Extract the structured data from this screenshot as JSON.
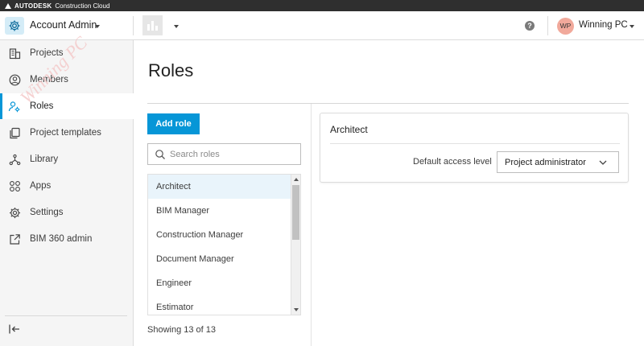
{
  "topbar": {
    "brand": "AUTODESK",
    "product": "Construction Cloud"
  },
  "header": {
    "app_name": "Account Admin",
    "help_label": "?",
    "user_initials": "WP",
    "user_name": "Winning PC"
  },
  "sidebar": {
    "items": [
      {
        "label": "Projects",
        "icon": "building-icon"
      },
      {
        "label": "Members",
        "icon": "person-circle-icon"
      },
      {
        "label": "Roles",
        "icon": "person-gear-icon"
      },
      {
        "label": "Project templates",
        "icon": "copy-icon"
      },
      {
        "label": "Library",
        "icon": "network-icon"
      },
      {
        "label": "Apps",
        "icon": "grid-icon"
      },
      {
        "label": "Settings",
        "icon": "gear-icon"
      },
      {
        "label": "BIM 360 admin",
        "icon": "external-link-icon"
      }
    ],
    "active_index": 2
  },
  "main": {
    "title": "Roles",
    "add_role_label": "Add role",
    "search_placeholder": "Search roles",
    "roles": [
      "Architect",
      "BIM Manager",
      "Construction Manager",
      "Document Manager",
      "Engineer",
      "Estimator"
    ],
    "selected_role": "Architect",
    "showing_text": "Showing 13 of 13"
  },
  "detail": {
    "title": "Architect",
    "access_label": "Default access level",
    "access_value": "Project administrator"
  },
  "watermark": "Winning PC",
  "colors": {
    "accent": "#0696d7",
    "selected_bg": "#e9f4fb",
    "avatar": "#f1a99b",
    "topstrip": "#2f2f2f"
  }
}
